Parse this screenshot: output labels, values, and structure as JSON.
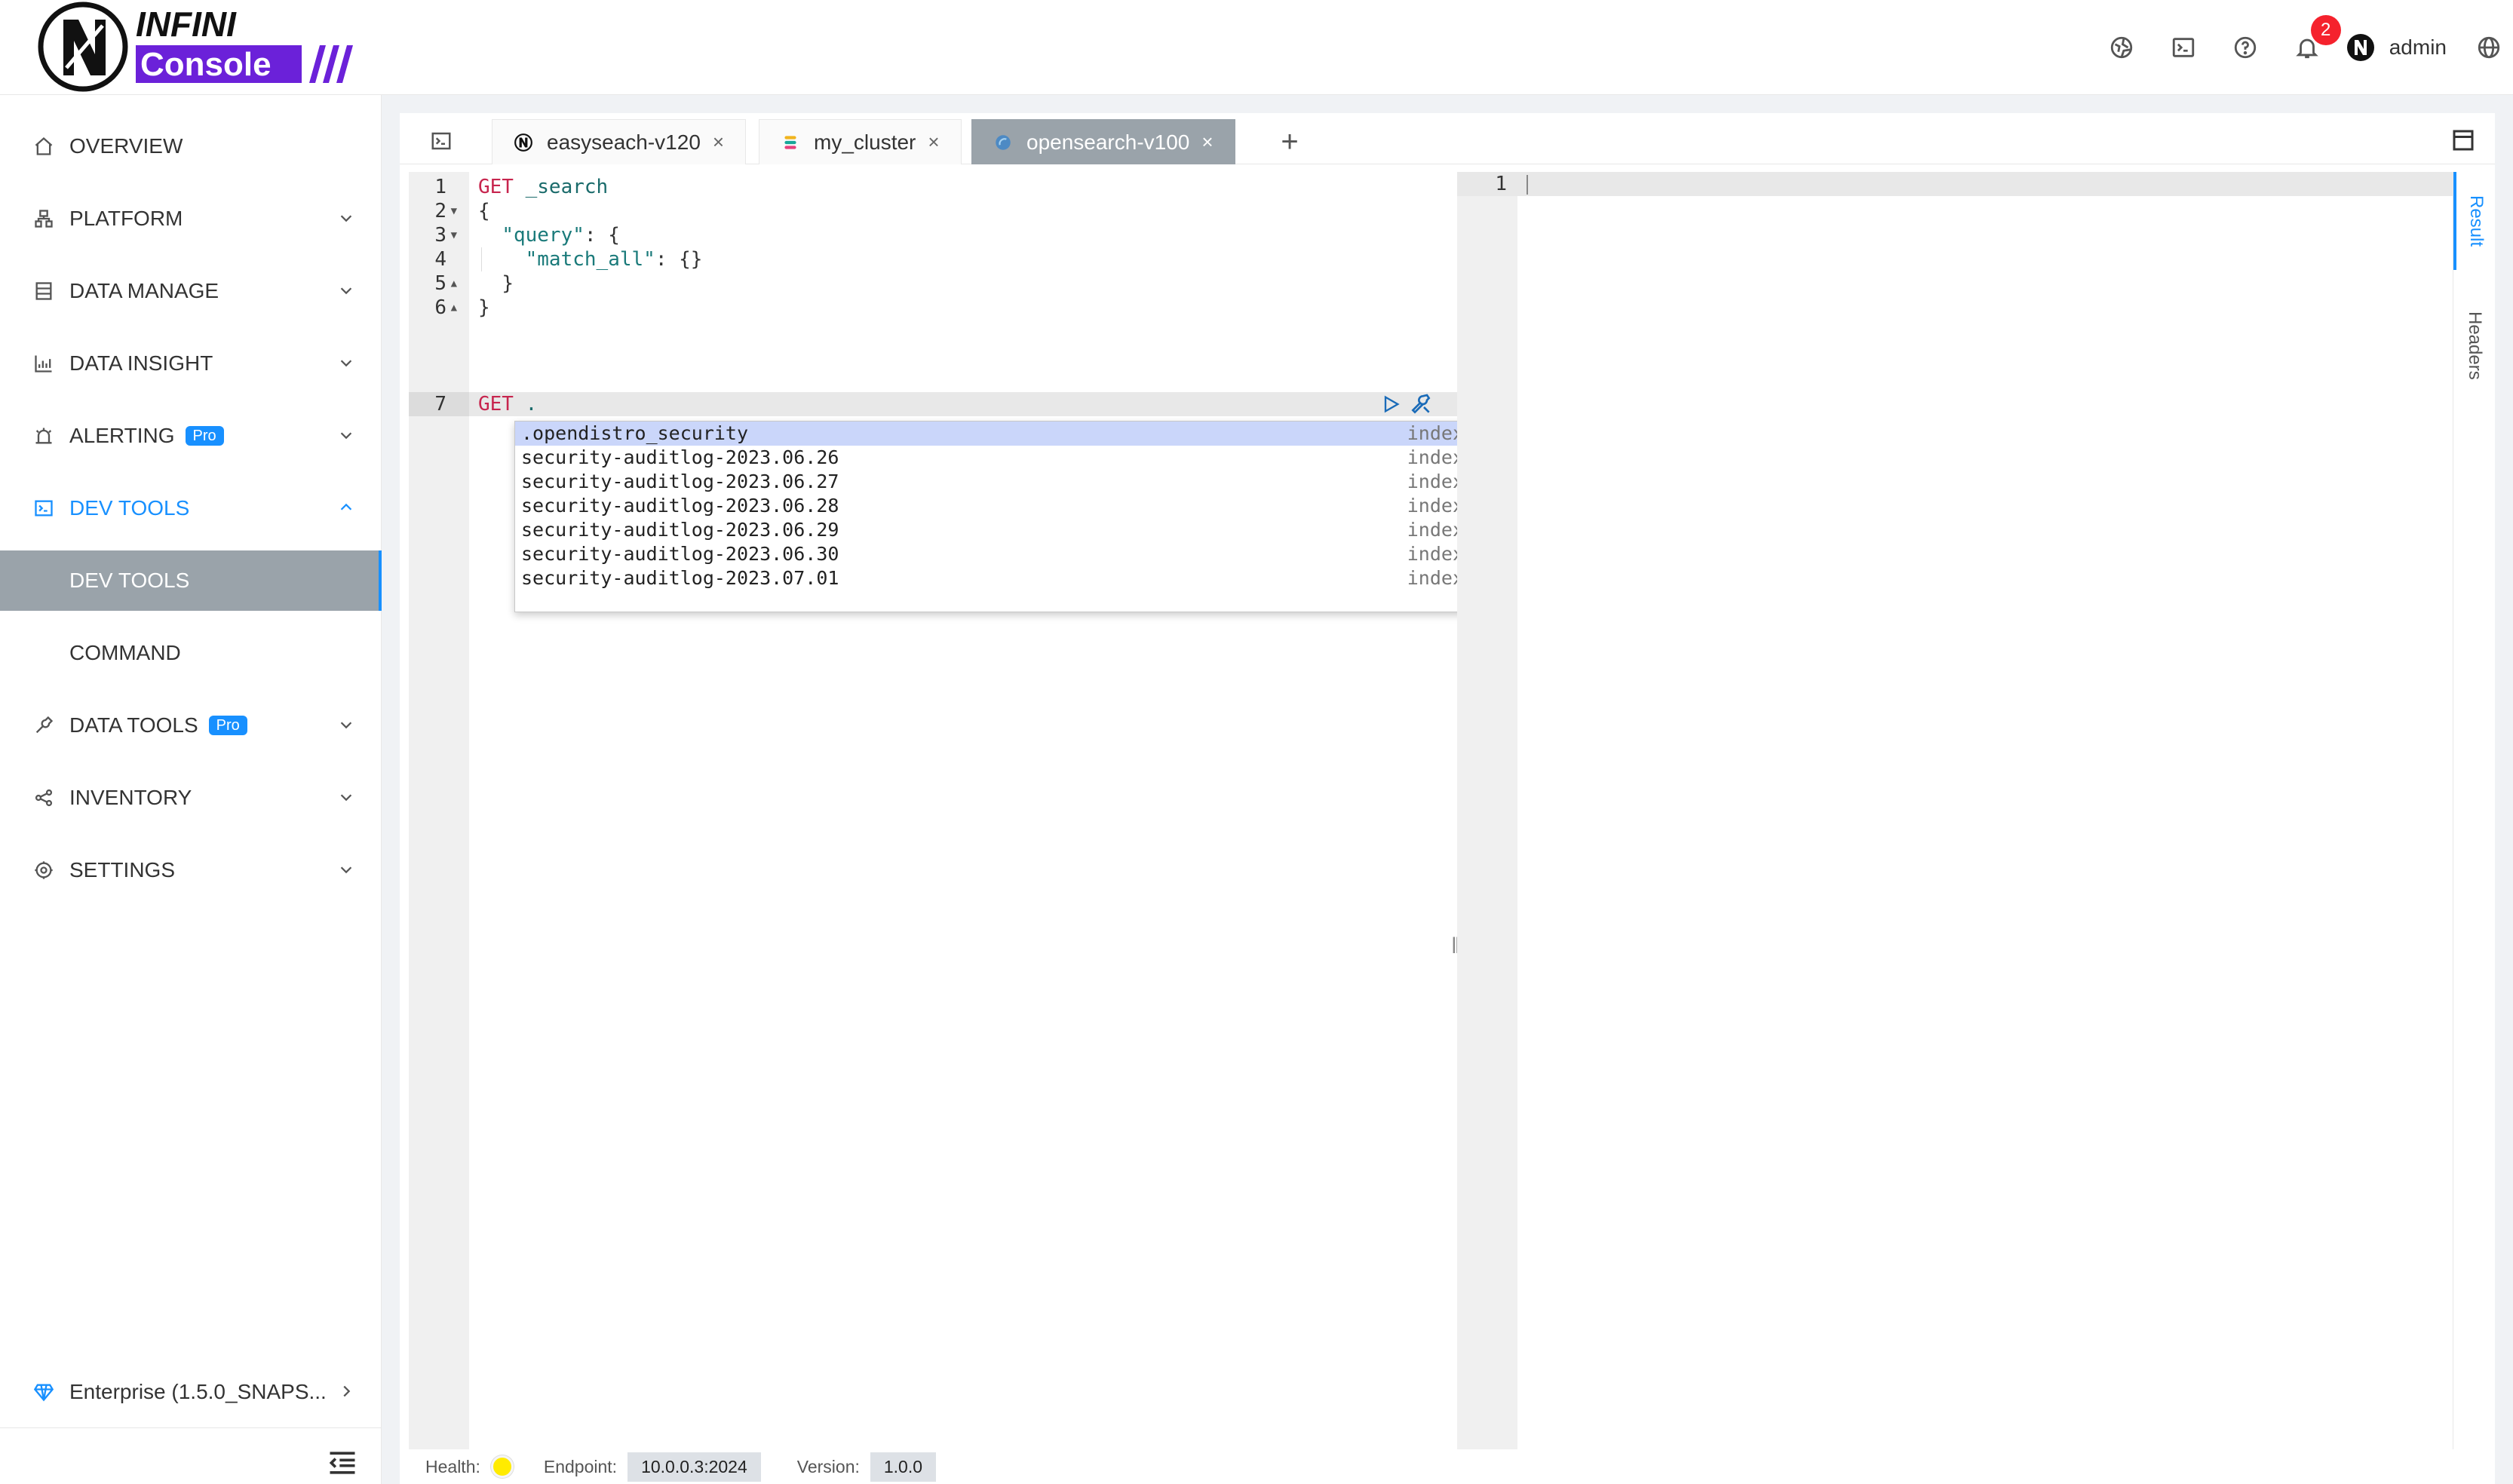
{
  "logo": {
    "line1": "INFINI",
    "line2": "Console"
  },
  "header": {
    "notification_count": "2",
    "user_name": "admin"
  },
  "sidebar": {
    "items": [
      {
        "label": "OVERVIEW"
      },
      {
        "label": "PLATFORM"
      },
      {
        "label": "DATA MANAGE"
      },
      {
        "label": "DATA INSIGHT"
      },
      {
        "label": "ALERTING",
        "badge": "Pro"
      },
      {
        "label": "DEV TOOLS"
      },
      {
        "label": "DATA TOOLS",
        "badge": "Pro"
      },
      {
        "label": "INVENTORY"
      },
      {
        "label": "SETTINGS"
      }
    ],
    "sub_items": [
      {
        "label": "DEV TOOLS"
      },
      {
        "label": "COMMAND"
      }
    ],
    "enterprise": "Enterprise (1.5.0_SNAPS..."
  },
  "tabs": [
    {
      "label": "easyseach-v120"
    },
    {
      "label": "my_cluster"
    },
    {
      "label": "opensearch-v100"
    }
  ],
  "editor": {
    "line_numbers": [
      "1",
      "2",
      "3",
      "4",
      "5",
      "6",
      "7"
    ],
    "line1_method": "GET",
    "line1_path": "_search",
    "line2": "{",
    "line3_key": "\"query\"",
    "line3_rest": ": {",
    "line4_key": "\"match_all\"",
    "line4_rest": ": {}",
    "line5": "}",
    "line6": "}",
    "line7_method": "GET",
    "line7_path": "."
  },
  "autocomplete": {
    "items": [
      {
        "name": ".opendistro_security",
        "meta": "index"
      },
      {
        "name": "security-auditlog-2023.06.26",
        "meta": "index"
      },
      {
        "name": "security-auditlog-2023.06.27",
        "meta": "index"
      },
      {
        "name": "security-auditlog-2023.06.28",
        "meta": "index"
      },
      {
        "name": "security-auditlog-2023.06.29",
        "meta": "index"
      },
      {
        "name": "security-auditlog-2023.06.30",
        "meta": "index"
      },
      {
        "name": "security-auditlog-2023.07.01",
        "meta": "index"
      }
    ]
  },
  "output": {
    "line_number": "1"
  },
  "side_tabs": [
    {
      "label": "Result"
    },
    {
      "label": "Headers"
    }
  ],
  "status": {
    "health_label": "Health:",
    "health_color": "#ffeb00",
    "endpoint_label": "Endpoint:",
    "endpoint": "10.0.0.3:2024",
    "version_label": "Version:",
    "version": "1.0.0"
  },
  "colors": {
    "accent": "#1890ff",
    "active_tab": "#9aa3aa",
    "logo_purple": "#6b21d9"
  },
  "icons": {
    "header": [
      "cluster-icon",
      "console-icon",
      "help-icon",
      "bell-icon",
      "avatar-icon",
      "language-icon"
    ]
  }
}
